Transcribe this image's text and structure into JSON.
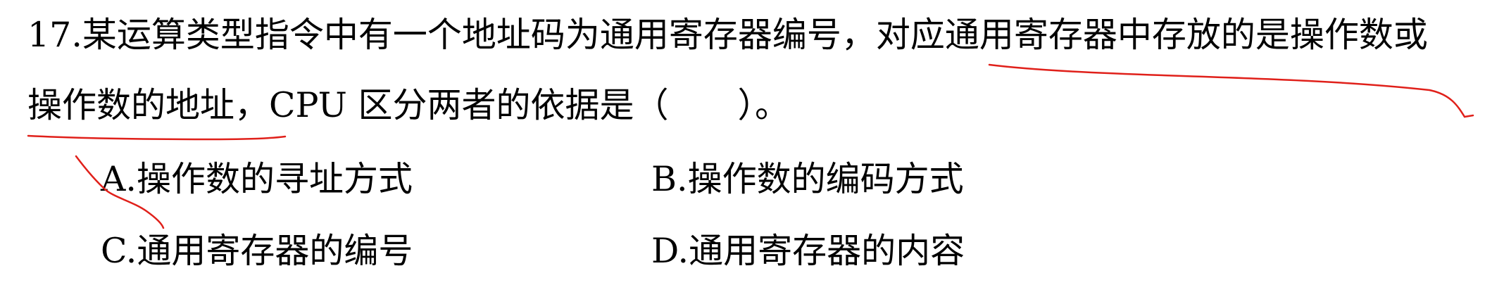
{
  "question": {
    "line1": "17.某运算类型指令中有一个地址码为通用寄存器编号，对应通用寄存器中存放的是操作数或",
    "line2": "操作数的地址，CPU 区分两者的依据是（　　）。"
  },
  "options": {
    "a": "A.操作数的寻址方式",
    "b": "B.操作数的编码方式",
    "c": "C.通用寄存器的编号",
    "d": "D.通用寄存器的内容"
  },
  "annotation_color": "#e0201a"
}
